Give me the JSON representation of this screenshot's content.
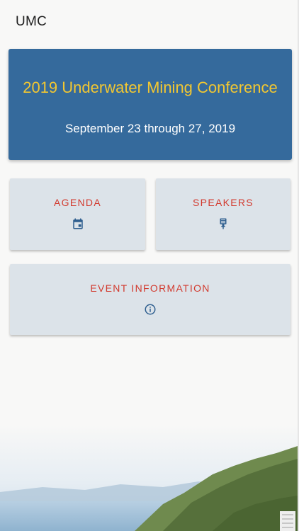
{
  "appbar": {
    "title": "UMC"
  },
  "hero": {
    "title": "2019 Underwater Mining Conference",
    "dates": "September 23 through 27, 2019"
  },
  "cards": {
    "agenda": {
      "label": "AGENDA",
      "icon": "calendar-icon"
    },
    "speakers": {
      "label": "SPEAKERS",
      "icon": "microphone-icon"
    },
    "event_info": {
      "label": "EVENT INFORMATION",
      "icon": "info-icon"
    }
  },
  "colors": {
    "hero_bg": "#356a9c",
    "hero_title": "#f2c731",
    "card_bg": "#dce3e9",
    "card_label": "#d23a2e",
    "icon": "#2f5f8f"
  }
}
